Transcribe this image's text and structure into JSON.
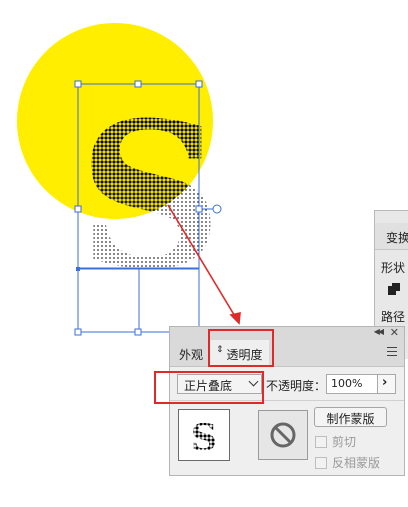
{
  "transform_panel": {
    "tab_label": "变换",
    "shape_label": "形状",
    "path_label": "路径",
    "shape_icon": "shape-square-icon"
  },
  "transparency_panel": {
    "tabs": [
      {
        "label": "外观"
      },
      {
        "label": "透明度"
      }
    ],
    "blend_mode": "正片叠底",
    "opacity_label": "不透明度：",
    "opacity_value": "100%",
    "opacity_arrow": "›",
    "make_mask_label": "制作蒙版",
    "clip_label": "剪切",
    "invert_mask_label": "反相蒙版",
    "collapse_icon": "double-chevron-icon",
    "close_icon": "close-icon",
    "menu_icon": "panel-menu-icon",
    "no_mask_icon": "prohibited-icon"
  },
  "artwork": {
    "circle_color": "#FFEE00",
    "selection_color": "#3B6FD9",
    "annotation_color": "#E02A2A",
    "glyph": "S"
  }
}
